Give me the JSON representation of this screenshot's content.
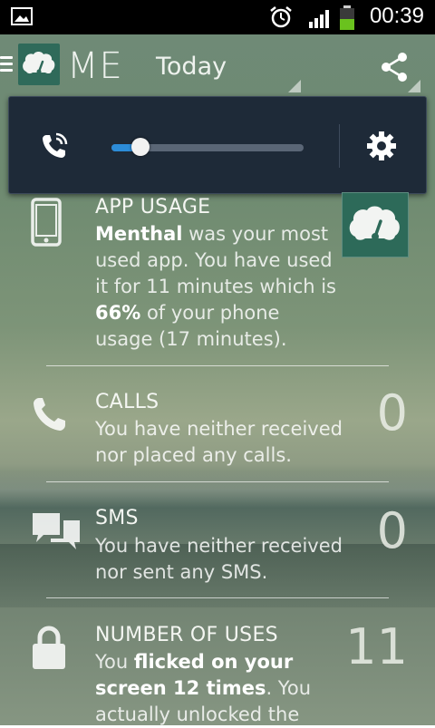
{
  "status_bar": {
    "time": "00:39",
    "icons": [
      "image-icon",
      "alarm-icon",
      "signal-icon",
      "battery-icon"
    ]
  },
  "action_bar": {
    "app_title": "ME",
    "period": "Today",
    "icons": [
      "menu-icon",
      "app-logo-icon",
      "share-icon"
    ]
  },
  "popup": {
    "icons": [
      "phone-ring-icon",
      "gear-icon"
    ],
    "slider_value": 0.15
  },
  "cards": {
    "app_usage": {
      "heading": "APP USAGE",
      "app_name": "Menthal",
      "text1": " was your most used app. You have used it for 11 minutes which is ",
      "percent": "66%",
      "text2": " of your phone usage (17 minutes)."
    },
    "calls": {
      "heading": "CALLS",
      "body": "You have neither received nor placed any calls.",
      "count": "0"
    },
    "sms": {
      "heading": "SMS",
      "body": "You have neither received nor sent any SMS.",
      "count": "0"
    },
    "uses": {
      "heading": "NUMBER OF USES",
      "text1": "You ",
      "bold1": "flicked on your screen 12 times",
      "text2": ". You actually unlocked the",
      "count": "11"
    }
  },
  "colors": {
    "accent": "#2c8cd8",
    "popup_bg": "#1e2a38",
    "logo_bg": "#2f6a5a"
  }
}
